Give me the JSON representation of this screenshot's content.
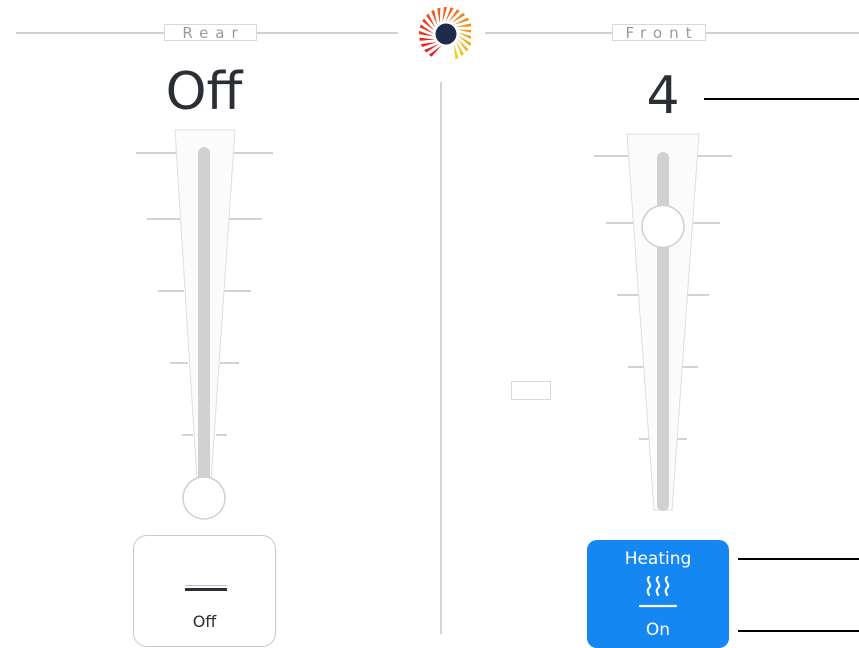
{
  "rear": {
    "section_label": "Rear",
    "value_text": "Off",
    "level": 0,
    "mode_label": "Off"
  },
  "front": {
    "section_label": "Front",
    "value_text": "4",
    "level": 4,
    "mode_title": "Heating",
    "mode_state": "On"
  },
  "colors": {
    "accent_blue": "#1487f2",
    "heat_red_top": "#e41c1c",
    "heat_red_bottom": "#ff4a12",
    "track_gray": "#d0d0d0"
  },
  "icons": {
    "logo": "radial-logo-icon",
    "heat": "heat-waves-icon"
  }
}
